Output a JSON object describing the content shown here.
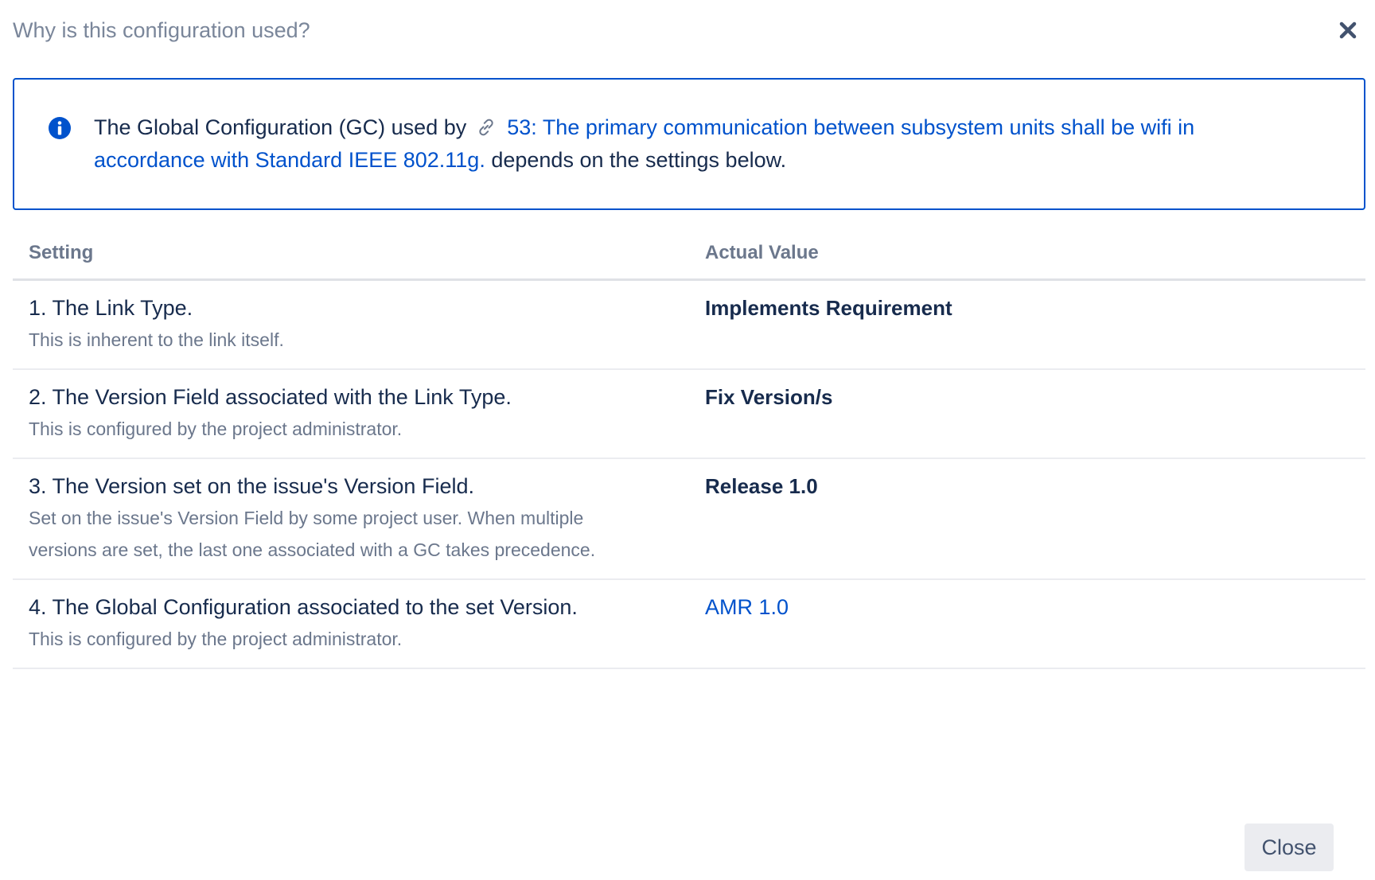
{
  "dialog": {
    "title": "Why is this configuration used?",
    "close_icon": "close-icon"
  },
  "info": {
    "icon": "info-icon",
    "text_before": "The Global Configuration (GC) used by",
    "link_icon": "link-icon",
    "issue_link": "53: The primary communication between subsystem units shall be wifi in accordance with Standard IEEE 802.11g.",
    "text_after": "depends on the settings below."
  },
  "table": {
    "headers": {
      "setting": "Setting",
      "actual_value": "Actual Value"
    },
    "rows": [
      {
        "setting": "1. The Link Type.",
        "description": "This is inherent to the link itself.",
        "value": "Implements Requirement"
      },
      {
        "setting": "2. The Version Field associated with the Link Type.",
        "description": "This is configured by the project administrator.",
        "value": "Fix Version/s"
      },
      {
        "setting": "3. The Version set on the issue's Version Field.",
        "description": "Set on the issue's Version Field by some project user. When multiple versions are set, the last one associated with a GC takes precedence.",
        "value": "Release 1.0"
      },
      {
        "setting": "4. The Global Configuration associated to the set Version.",
        "description": "This is configured by the project administrator.",
        "value": "AMR 1.0"
      }
    ]
  },
  "footer": {
    "close_label": "Close"
  },
  "colors": {
    "accent": "#0052cc",
    "muted_text": "#6b778c",
    "text": "#172b4d",
    "button_bg": "#ebecf0"
  }
}
